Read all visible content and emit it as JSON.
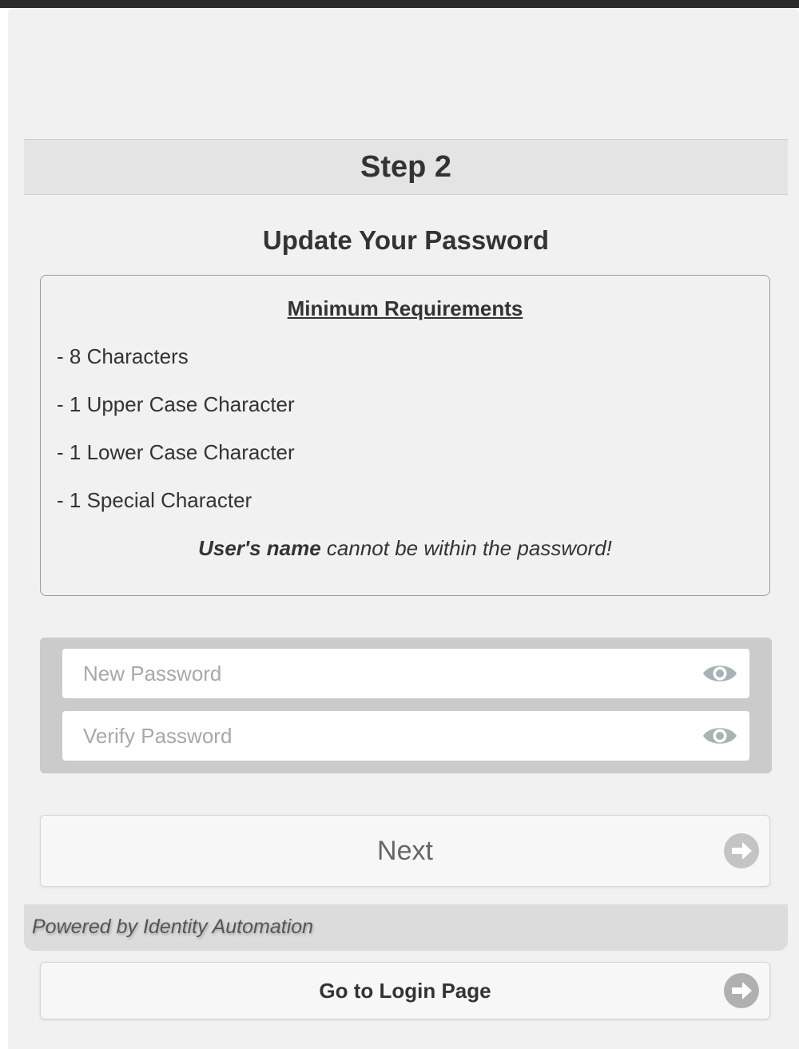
{
  "step": {
    "title": "Step 2"
  },
  "page": {
    "title": "Update Your Password"
  },
  "requirements": {
    "title": "Minimum Requirements",
    "items": [
      "- 8 Characters",
      "- 1 Upper Case Character",
      "- 1 Lower Case Character",
      "- 1 Special Character"
    ],
    "note_bold": "User's name",
    "note_rest": " cannot be within the password!"
  },
  "form": {
    "new_password_placeholder": "New Password",
    "verify_password_placeholder": "Verify Password"
  },
  "buttons": {
    "next_label": "Next",
    "login_label": "Go to Login Page"
  },
  "footer": {
    "powered_by": "Powered by Identity Automation"
  },
  "icons": {
    "eye": "eye-icon",
    "arrow": "arrow-right-circle-icon"
  },
  "colors": {
    "panel_bg": "#f1f1f1",
    "header_bg": "#e4e4e4",
    "icon_gray": "#b5b5b5",
    "eye_gray": "#a9b2b5"
  }
}
